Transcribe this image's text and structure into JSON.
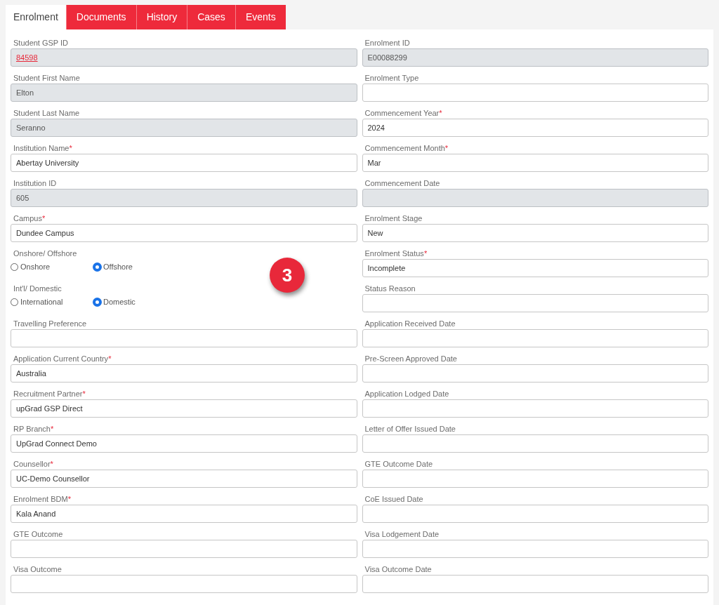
{
  "tabs": [
    {
      "label": "Enrolment",
      "selected": true
    },
    {
      "label": "Documents",
      "selected": false
    },
    {
      "label": "History",
      "selected": false
    },
    {
      "label": "Cases",
      "selected": false
    },
    {
      "label": "Events",
      "selected": false
    }
  ],
  "rows": [
    {
      "left": {
        "kind": "text",
        "label": "Student GSP ID",
        "value": "84598",
        "readonly": true,
        "link": true
      },
      "right": {
        "kind": "text",
        "label": "Enrolment ID",
        "value": "E00088299",
        "readonly": true
      }
    },
    {
      "left": {
        "kind": "text",
        "label": "Student First Name",
        "value": "Elton",
        "readonly": true
      },
      "right": {
        "kind": "text",
        "label": "Enrolment Type",
        "readonly": false
      }
    },
    {
      "left": {
        "kind": "text",
        "label": "Student Last Name",
        "value": "Seranno",
        "readonly": true
      },
      "right": {
        "kind": "text",
        "label": "Commencement Year",
        "mark": "*",
        "value": "2024",
        "readonly": false
      }
    },
    {
      "left": {
        "kind": "text",
        "label": "Institution Name",
        "mark": "*",
        "value": "Abertay University",
        "readonly": false
      },
      "right": {
        "kind": "text",
        "label": "Commencement Month",
        "mark": "*",
        "value": "Mar",
        "readonly": false
      }
    },
    {
      "left": {
        "kind": "text",
        "label": "Institution ID",
        "value": "605",
        "readonly": true
      },
      "right": {
        "kind": "text",
        "label": "Commencement Date",
        "readonly": true
      }
    },
    {
      "left": {
        "kind": "text",
        "label": "Campus",
        "mark": "*",
        "value": "Dundee Campus",
        "readonly": false
      },
      "right": {
        "kind": "text",
        "label": "Enrolment Stage",
        "value": "New",
        "readonly": false
      }
    },
    {
      "left": {
        "kind": "radio",
        "label": "Onshore/ Offshore",
        "options": [
          {
            "label": "Onshore",
            "selected": false
          },
          {
            "label": "Offshore",
            "selected": true
          }
        ]
      },
      "right": {
        "kind": "text",
        "label": "Enrolment Status",
        "mark": "*",
        "value": "Incomplete",
        "readonly": false
      }
    },
    {
      "left": {
        "kind": "radio",
        "label": "Int'l/ Domestic",
        "options": [
          {
            "label": "International",
            "selected": false
          },
          {
            "label": "Domestic",
            "selected": true
          }
        ]
      },
      "right": {
        "kind": "text",
        "label": "Status Reason",
        "readonly": false
      }
    },
    {
      "left": {
        "kind": "text",
        "label": "Travelling Preference",
        "readonly": false
      },
      "right": {
        "kind": "text",
        "label": "Application Received Date",
        "readonly": false
      }
    },
    {
      "left": {
        "kind": "text",
        "label": "Application Current Country",
        "mark": "*",
        "value": "Australia",
        "readonly": false
      },
      "right": {
        "kind": "text",
        "label": "Pre-Screen Approved Date",
        "readonly": false
      }
    },
    {
      "left": {
        "kind": "text",
        "label": "Recruitment Partner",
        "mark": "*",
        "value": "upGrad GSP Direct",
        "readonly": false
      },
      "right": {
        "kind": "text",
        "label": "Application Lodged Date",
        "readonly": false
      }
    },
    {
      "left": {
        "kind": "text",
        "label": "RP Branch",
        "mark": "*",
        "value": "UpGrad Connect Demo",
        "readonly": false
      },
      "right": {
        "kind": "text",
        "label": "Letter of Offer Issued Date",
        "readonly": false
      }
    },
    {
      "left": {
        "kind": "text",
        "label": "Counsellor",
        "mark": "*",
        "value": "UC-Demo Counsellor",
        "readonly": false
      },
      "right": {
        "kind": "text",
        "label": "GTE Outcome Date",
        "readonly": false
      }
    },
    {
      "left": {
        "kind": "text",
        "label": "Enrolment BDM",
        "mark": "*",
        "value": "Kala Anand",
        "readonly": false
      },
      "right": {
        "kind": "text",
        "label": "CoE Issued Date",
        "readonly": false
      }
    },
    {
      "left": {
        "kind": "text",
        "label": "GTE Outcome",
        "readonly": false
      },
      "right": {
        "kind": "text",
        "label": "Visa Lodgement Date",
        "readonly": false
      }
    },
    {
      "left": {
        "kind": "text",
        "label": "Visa Outcome",
        "readonly": false
      },
      "right": {
        "kind": "text",
        "label": "Visa Outcome Date",
        "readonly": false
      }
    }
  ],
  "step_badge": "3"
}
